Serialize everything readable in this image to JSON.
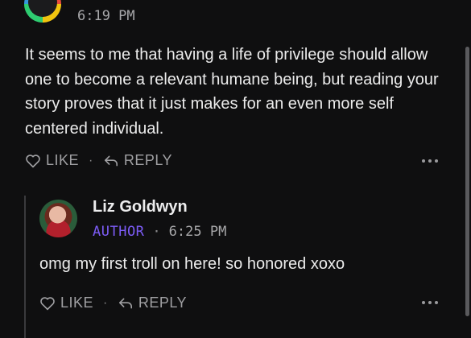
{
  "top_comment": {
    "timestamp": "6:19 PM",
    "text": "It seems to me that having a life of privilege should allow one to become a relevant humane being, but reading your story proves that it just makes for an even more self centered individual.",
    "like_label": "LIKE",
    "separator": "·",
    "reply_label": "REPLY"
  },
  "reply": {
    "author": "Liz Goldwyn",
    "badge": "AUTHOR",
    "separator": "·",
    "timestamp": "6:25 PM",
    "text": "omg my first troll on here! so honored xoxo",
    "like_label": "LIKE",
    "reply_label": "REPLY"
  },
  "colors": {
    "background": "#0f0f10",
    "author_badge": "#7c5cf6",
    "muted": "#a0a0a3"
  },
  "icons": [
    "heart-icon",
    "reply-arrow-icon",
    "more-options-icon"
  ]
}
